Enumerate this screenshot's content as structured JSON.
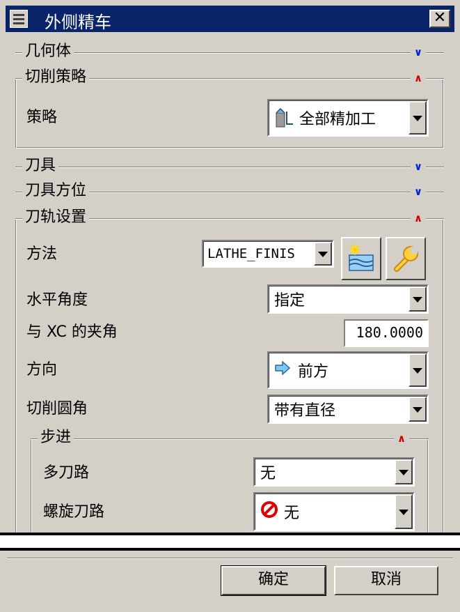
{
  "window": {
    "title": "外侧精车",
    "close_label": "✕"
  },
  "sections": {
    "geometry": {
      "title": "几何体",
      "state": "collapsed"
    },
    "cut_strategy": {
      "title": "切削策略",
      "state": "expanded",
      "strategy_label": "策略",
      "strategy_value": "全部精加工"
    },
    "tool": {
      "title": "刀具",
      "state": "collapsed"
    },
    "tool_orientation": {
      "title": "刀具方位",
      "state": "collapsed"
    },
    "path_settings": {
      "title": "刀轨设置",
      "state": "expanded",
      "method_label": "方法",
      "method_value": "LATHE_FINIS",
      "horizontal_angle_label": "水平角度",
      "horizontal_angle_value": "指定",
      "xc_angle_label": "与 XC 的夹角",
      "xc_angle_value": "180.0000",
      "direction_label": "方向",
      "direction_value": "前方",
      "corner_label": "切削圆角",
      "corner_value": "带有直径",
      "stepover": {
        "title": "步进",
        "state": "expanded",
        "multi_pass_label": "多刀路",
        "multi_pass_value": "无",
        "spiral_label": "螺旋刀路",
        "spiral_value": "无"
      }
    }
  },
  "footer": {
    "ok_label": "确定",
    "cancel_label": "取消"
  },
  "icons": {
    "collapsed": "chevron-double-down-icon",
    "expanded": "chevron-double-up-icon",
    "strategy": "finish-all-icon",
    "direction": "arrow-right-icon",
    "spiral": "prohibited-icon",
    "method_new": "new-method-icon",
    "method_edit": "wrench-icon"
  },
  "colors": {
    "titlebar": "#0a246a",
    "collapse_arrows": "#0020d0",
    "expand_arrows": "#d00000",
    "face": "#d4d0c8"
  }
}
